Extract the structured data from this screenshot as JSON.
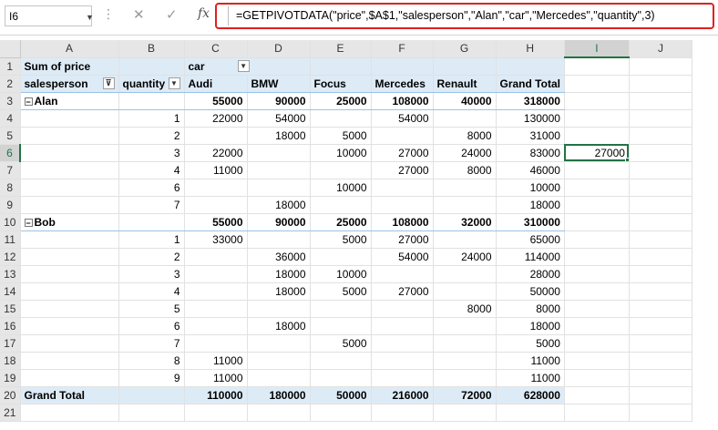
{
  "formula_bar": {
    "name_box": "I6",
    "cancel_icon": "✕",
    "enter_icon": "✓",
    "fx_label": "fx",
    "formula": "=GETPIVOTDATA(\"price\",$A$1,\"salesperson\",\"Alan\",\"car\",\"Mercedes\",\"quantity\",3)"
  },
  "columns": [
    "A",
    "B",
    "C",
    "D",
    "E",
    "F",
    "G",
    "H",
    "I",
    "J"
  ],
  "selected_col": "I",
  "selected_row": 6,
  "pivot": {
    "title": "Sum of price",
    "col_field": "car",
    "row_field_1": "salesperson",
    "row_field_2": "quantity",
    "col_headers": [
      "Audi",
      "BMW",
      "Focus",
      "Mercedes",
      "Renault",
      "Grand Total"
    ],
    "rows": [
      {
        "r": 3,
        "a": "Alan",
        "b": "",
        "v": [
          "55000",
          "90000",
          "25000",
          "108000",
          "40000",
          "318000"
        ],
        "group": true
      },
      {
        "r": 4,
        "a": "",
        "b": "1",
        "v": [
          "22000",
          "54000",
          "",
          "54000",
          "",
          "130000"
        ]
      },
      {
        "r": 5,
        "a": "",
        "b": "2",
        "v": [
          "",
          "18000",
          "5000",
          "",
          "8000",
          "31000"
        ]
      },
      {
        "r": 6,
        "a": "",
        "b": "3",
        "v": [
          "22000",
          "",
          "10000",
          "27000",
          "24000",
          "83000"
        ],
        "i": "27000"
      },
      {
        "r": 7,
        "a": "",
        "b": "4",
        "v": [
          "11000",
          "",
          "",
          "27000",
          "8000",
          "46000"
        ]
      },
      {
        "r": 8,
        "a": "",
        "b": "6",
        "v": [
          "",
          "",
          "10000",
          "",
          "",
          "10000"
        ]
      },
      {
        "r": 9,
        "a": "",
        "b": "7",
        "v": [
          "",
          "18000",
          "",
          "",
          "",
          "18000"
        ]
      },
      {
        "r": 10,
        "a": "Bob",
        "b": "",
        "v": [
          "55000",
          "90000",
          "25000",
          "108000",
          "32000",
          "310000"
        ],
        "group": true
      },
      {
        "r": 11,
        "a": "",
        "b": "1",
        "v": [
          "33000",
          "",
          "5000",
          "27000",
          "",
          "65000"
        ]
      },
      {
        "r": 12,
        "a": "",
        "b": "2",
        "v": [
          "",
          "36000",
          "",
          "54000",
          "24000",
          "114000"
        ]
      },
      {
        "r": 13,
        "a": "",
        "b": "3",
        "v": [
          "",
          "18000",
          "10000",
          "",
          "",
          "28000"
        ]
      },
      {
        "r": 14,
        "a": "",
        "b": "4",
        "v": [
          "",
          "18000",
          "5000",
          "27000",
          "",
          "50000"
        ]
      },
      {
        "r": 15,
        "a": "",
        "b": "5",
        "v": [
          "",
          "",
          "",
          "",
          "8000",
          "8000"
        ]
      },
      {
        "r": 16,
        "a": "",
        "b": "6",
        "v": [
          "",
          "18000",
          "",
          "",
          "",
          "18000"
        ]
      },
      {
        "r": 17,
        "a": "",
        "b": "7",
        "v": [
          "",
          "",
          "5000",
          "",
          "",
          "5000"
        ]
      },
      {
        "r": 18,
        "a": "",
        "b": "8",
        "v": [
          "11000",
          "",
          "",
          "",
          "",
          "11000"
        ]
      },
      {
        "r": 19,
        "a": "",
        "b": "9",
        "v": [
          "11000",
          "",
          "",
          "",
          "",
          "11000"
        ]
      }
    ],
    "grand_total": {
      "r": 20,
      "label": "Grand Total",
      "v": [
        "110000",
        "180000",
        "50000",
        "216000",
        "72000",
        "628000"
      ]
    }
  }
}
